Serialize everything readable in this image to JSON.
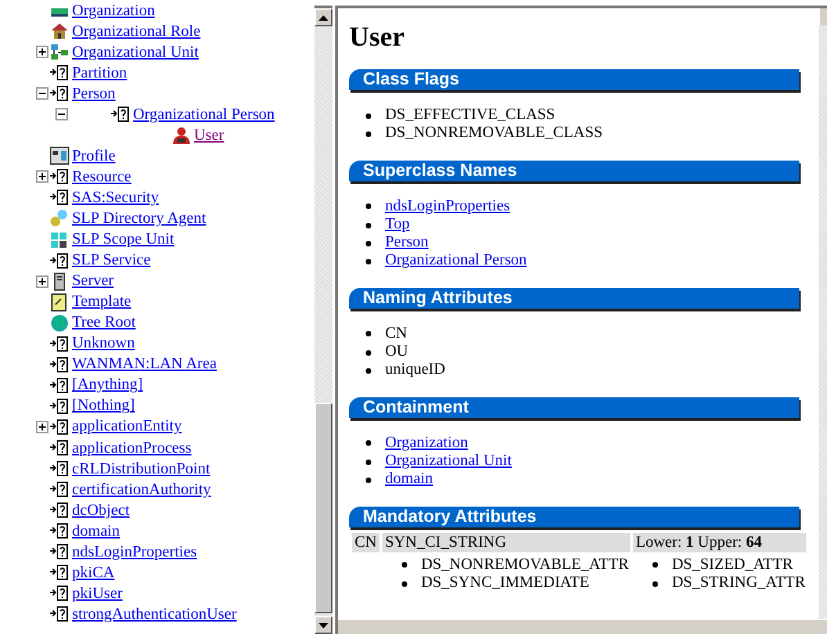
{
  "tree": {
    "items": [
      {
        "label": "Organization",
        "kind": "org",
        "selected": false
      },
      {
        "label": "Organizational Role",
        "kind": "role",
        "selected": false
      },
      {
        "label": "Organizational Unit",
        "kind": "unit",
        "selected": false,
        "expanded": false
      },
      {
        "label": "Partition",
        "kind": "unknown",
        "selected": false
      },
      {
        "label": "Person",
        "kind": "unknown",
        "selected": false,
        "expanded": true,
        "children": [
          {
            "label": "Organizational Person",
            "kind": "unknown",
            "selected": false,
            "expanded": true,
            "children": [
              {
                "label": "User",
                "kind": "user",
                "selected": true
              }
            ]
          }
        ]
      },
      {
        "label": "Profile",
        "kind": "profile",
        "selected": false
      },
      {
        "label": "Resource",
        "kind": "unknown",
        "selected": false,
        "expanded": false
      },
      {
        "label": "SAS:Security",
        "kind": "unknown",
        "selected": false
      },
      {
        "label": "SLP Directory Agent",
        "kind": "agent",
        "selected": false
      },
      {
        "label": "SLP Scope Unit",
        "kind": "scope",
        "selected": false
      },
      {
        "label": "SLP Service",
        "kind": "unknown",
        "selected": false
      },
      {
        "label": "Server",
        "kind": "server",
        "selected": false,
        "expanded": false
      },
      {
        "label": "Template",
        "kind": "template",
        "selected": false
      },
      {
        "label": "Tree Root",
        "kind": "globe",
        "selected": false
      },
      {
        "label": "Unknown",
        "kind": "unknown",
        "selected": false
      },
      {
        "label": "WANMAN:LAN Area",
        "kind": "unknown",
        "selected": false
      },
      {
        "label": "[Anything]",
        "kind": "unknown",
        "selected": false
      },
      {
        "label": "[Nothing]",
        "kind": "unknown",
        "selected": false
      },
      {
        "label": "applicationEntity",
        "kind": "unknown",
        "selected": false,
        "expanded": false
      },
      {
        "label": "applicationProcess",
        "kind": "unknown",
        "selected": false
      },
      {
        "label": "cRLDistributionPoint",
        "kind": "unknown",
        "selected": false
      },
      {
        "label": "certificationAuthority",
        "kind": "unknown",
        "selected": false
      },
      {
        "label": "dcObject",
        "kind": "unknown",
        "selected": false
      },
      {
        "label": "domain",
        "kind": "unknown",
        "selected": false
      },
      {
        "label": "ndsLoginProperties",
        "kind": "unknown",
        "selected": false
      },
      {
        "label": "pkiCA",
        "kind": "unknown",
        "selected": false
      },
      {
        "label": "pkiUser",
        "kind": "unknown",
        "selected": false
      },
      {
        "label": "strongAuthenticationUser",
        "kind": "unknown",
        "selected": false
      }
    ]
  },
  "content": {
    "title": "User",
    "sections": [
      {
        "title": "Class Flags",
        "kind": "list",
        "items": [
          {
            "text": "DS_EFFECTIVE_CLASS",
            "link": false
          },
          {
            "text": "DS_NONREMOVABLE_CLASS",
            "link": false
          }
        ]
      },
      {
        "title": "Superclass Names",
        "kind": "list",
        "items": [
          {
            "text": "ndsLoginProperties",
            "link": true
          },
          {
            "text": "Top",
            "link": true
          },
          {
            "text": "Person",
            "link": true
          },
          {
            "text": "Organizational Person",
            "link": true
          }
        ]
      },
      {
        "title": "Naming Attributes",
        "kind": "list",
        "items": [
          {
            "text": "CN",
            "link": false
          },
          {
            "text": "OU",
            "link": false
          },
          {
            "text": "uniqueID",
            "link": false
          }
        ]
      },
      {
        "title": "Containment",
        "kind": "list",
        "items": [
          {
            "text": "Organization",
            "link": true
          },
          {
            "text": "Organizational Unit",
            "link": true
          },
          {
            "text": "domain",
            "link": true
          }
        ]
      },
      {
        "title": "Mandatory Attributes",
        "kind": "table",
        "rows": [
          {
            "name": "CN",
            "syntax": "SYN_CI_STRING",
            "bounds": "Lower: **1** Upper: **64**",
            "flags": [
              [
                "DS_NONREMOVABLE_ATTR",
                "DS_SYNC_IMMEDIATE"
              ],
              [
                "DS_SIZED_ATTR",
                "DS_STRING_ATTR"
              ]
            ]
          }
        ]
      }
    ]
  }
}
